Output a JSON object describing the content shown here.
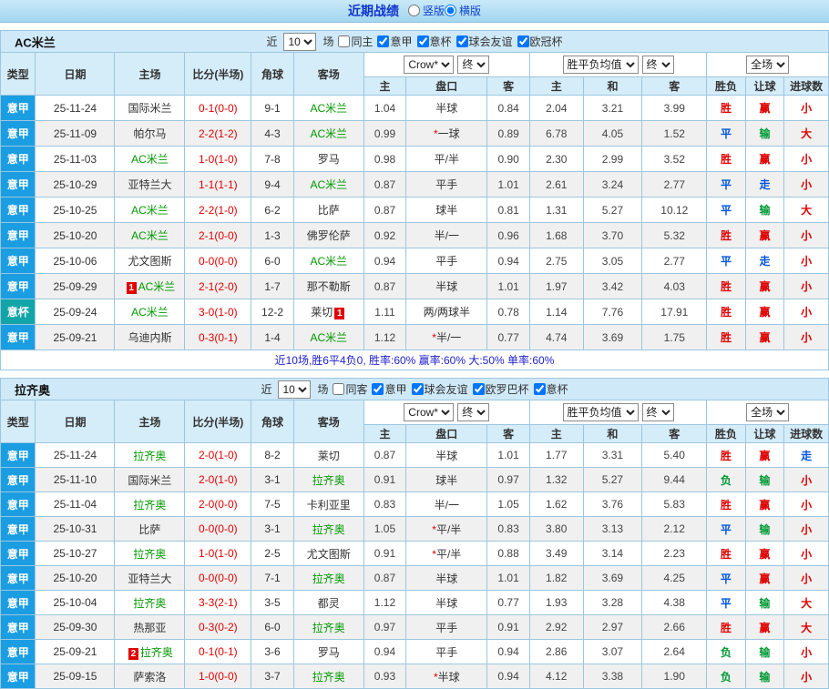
{
  "colors": {
    "topbar_bg": "#a3d6ef",
    "header_bg": "#d5ecf9",
    "border": "#9cc6e0",
    "type_blue": "#1b9de2",
    "type_teal": "#12a5a8",
    "red": "#e00000",
    "green": "#009933",
    "blue": "#0055dd",
    "team_green": "#009900",
    "summary_blue": "#2222cc"
  },
  "top_bar": {
    "title": "近期战绩",
    "layout_options": [
      {
        "label": "竖版",
        "selected": false
      },
      {
        "label": "横版",
        "selected": true
      }
    ]
  },
  "sections": [
    {
      "team": "AC米兰",
      "near_label": "近",
      "matches_count": "10",
      "matches_unit": "场",
      "filters": [
        {
          "label": "同主",
          "checked": false
        },
        {
          "label": "意甲",
          "checked": true
        },
        {
          "label": "意杯",
          "checked": true
        },
        {
          "label": "球会友谊",
          "checked": true
        },
        {
          "label": "欧冠杯",
          "checked": true
        }
      ],
      "odds_company": "Crow*",
      "odds_stage": "终",
      "europe_mode": "胜平负均值",
      "europe_stage": "终",
      "scope": "全场",
      "left_headers": [
        "类型",
        "日期",
        "主场",
        "比分(半场)",
        "角球",
        "客场"
      ],
      "sub_headers": [
        "主",
        "盘口",
        "客",
        "主",
        "和",
        "客",
        "胜负",
        "让球",
        "进球数"
      ],
      "rows": [
        {
          "type": "意甲",
          "date": "25-11-24",
          "home": "国际米兰",
          "home_hl": false,
          "home_badge": "",
          "score": "0-1(0-0)",
          "corners": "9-1",
          "away": "AC米兰",
          "away_hl": true,
          "away_badge": "",
          "asia_home": "1.04",
          "handicap": "半球",
          "asia_away": "0.84",
          "eu_home": "2.04",
          "eu_draw": "3.21",
          "eu_away": "3.99",
          "result": "胜",
          "handicap_result": "赢",
          "goals": "小"
        },
        {
          "type": "意甲",
          "date": "25-11-09",
          "home": "帕尔马",
          "home_hl": false,
          "home_badge": "",
          "score": "2-2(1-2)",
          "corners": "4-3",
          "away": "AC米兰",
          "away_hl": true,
          "away_badge": "",
          "asia_home": "0.99",
          "handicap": "*一球",
          "asia_away": "0.89",
          "eu_home": "6.78",
          "eu_draw": "4.05",
          "eu_away": "1.52",
          "result": "平",
          "handicap_result": "输",
          "goals": "大"
        },
        {
          "type": "意甲",
          "date": "25-11-03",
          "home": "AC米兰",
          "home_hl": true,
          "home_badge": "",
          "score": "1-0(1-0)",
          "corners": "7-8",
          "away": "罗马",
          "away_hl": false,
          "away_badge": "",
          "asia_home": "0.98",
          "handicap": "平/半",
          "asia_away": "0.90",
          "eu_home": "2.30",
          "eu_draw": "2.99",
          "eu_away": "3.52",
          "result": "胜",
          "handicap_result": "赢",
          "goals": "小"
        },
        {
          "type": "意甲",
          "date": "25-10-29",
          "home": "亚特兰大",
          "home_hl": false,
          "home_badge": "",
          "score": "1-1(1-1)",
          "corners": "9-4",
          "away": "AC米兰",
          "away_hl": true,
          "away_badge": "",
          "asia_home": "0.87",
          "handicap": "平手",
          "asia_away": "1.01",
          "eu_home": "2.61",
          "eu_draw": "3.24",
          "eu_away": "2.77",
          "result": "平",
          "handicap_result": "走",
          "goals": "小"
        },
        {
          "type": "意甲",
          "date": "25-10-25",
          "home": "AC米兰",
          "home_hl": true,
          "home_badge": "",
          "score": "2-2(1-0)",
          "corners": "6-2",
          "away": "比萨",
          "away_hl": false,
          "away_badge": "",
          "asia_home": "0.87",
          "handicap": "球半",
          "asia_away": "0.81",
          "eu_home": "1.31",
          "eu_draw": "5.27",
          "eu_away": "10.12",
          "result": "平",
          "handicap_result": "输",
          "goals": "大"
        },
        {
          "type": "意甲",
          "date": "25-10-20",
          "home": "AC米兰",
          "home_hl": true,
          "home_badge": "",
          "score": "2-1(0-0)",
          "corners": "1-3",
          "away": "佛罗伦萨",
          "away_hl": false,
          "away_badge": "",
          "asia_home": "0.92",
          "handicap": "半/一",
          "asia_away": "0.96",
          "eu_home": "1.68",
          "eu_draw": "3.70",
          "eu_away": "5.32",
          "result": "胜",
          "handicap_result": "赢",
          "goals": "小"
        },
        {
          "type": "意甲",
          "date": "25-10-06",
          "home": "尤文图斯",
          "home_hl": false,
          "home_badge": "",
          "score": "0-0(0-0)",
          "corners": "6-0",
          "away": "AC米兰",
          "away_hl": true,
          "away_badge": "",
          "asia_home": "0.94",
          "handicap": "平手",
          "asia_away": "0.94",
          "eu_home": "2.75",
          "eu_draw": "3.05",
          "eu_away": "2.77",
          "result": "平",
          "handicap_result": "走",
          "goals": "小"
        },
        {
          "type": "意甲",
          "date": "25-09-29",
          "home": "AC米兰",
          "home_hl": true,
          "home_badge": "1",
          "score": "2-1(2-0)",
          "corners": "1-7",
          "away": "那不勒斯",
          "away_hl": false,
          "away_badge": "",
          "asia_home": "0.87",
          "handicap": "半球",
          "asia_away": "1.01",
          "eu_home": "1.97",
          "eu_draw": "3.42",
          "eu_away": "4.03",
          "result": "胜",
          "handicap_result": "赢",
          "goals": "小"
        },
        {
          "type": "意杯",
          "date": "25-09-24",
          "home": "AC米兰",
          "home_hl": true,
          "home_badge": "",
          "score": "3-0(1-0)",
          "corners": "12-2",
          "away": "莱切",
          "away_hl": false,
          "away_badge": "1",
          "asia_home": "1.11",
          "handicap": "两/两球半",
          "asia_away": "0.78",
          "eu_home": "1.14",
          "eu_draw": "7.76",
          "eu_away": "17.91",
          "result": "胜",
          "handicap_result": "赢",
          "goals": "小"
        },
        {
          "type": "意甲",
          "date": "25-09-21",
          "home": "乌迪内斯",
          "home_hl": false,
          "home_badge": "",
          "score": "0-3(0-1)",
          "corners": "1-4",
          "away": "AC米兰",
          "away_hl": true,
          "away_badge": "",
          "asia_home": "1.12",
          "handicap": "*半/一",
          "asia_away": "0.77",
          "eu_home": "4.74",
          "eu_draw": "3.69",
          "eu_away": "1.75",
          "result": "胜",
          "handicap_result": "赢",
          "goals": "小"
        }
      ],
      "summary": "近10场,胜6平4负0, 胜率:60% 赢率:60% 大:50% 单率:60%"
    },
    {
      "team": "拉齐奥",
      "near_label": "近",
      "matches_count": "10",
      "matches_unit": "场",
      "filters": [
        {
          "label": "同客",
          "checked": false
        },
        {
          "label": "意甲",
          "checked": true
        },
        {
          "label": "球会友谊",
          "checked": true
        },
        {
          "label": "欧罗巴杯",
          "checked": true
        },
        {
          "label": "意杯",
          "checked": true
        }
      ],
      "odds_company": "Crow*",
      "odds_stage": "终",
      "europe_mode": "胜平负均值",
      "europe_stage": "终",
      "scope": "全场",
      "left_headers": [
        "类型",
        "日期",
        "主场",
        "比分(半场)",
        "角球",
        "客场"
      ],
      "sub_headers": [
        "主",
        "盘口",
        "客",
        "主",
        "和",
        "客",
        "胜负",
        "让球",
        "进球数"
      ],
      "rows": [
        {
          "type": "意甲",
          "date": "25-11-24",
          "home": "拉齐奥",
          "home_hl": true,
          "home_badge": "",
          "score": "2-0(1-0)",
          "corners": "8-2",
          "away": "莱切",
          "away_hl": false,
          "away_badge": "",
          "asia_home": "0.87",
          "handicap": "半球",
          "asia_away": "1.01",
          "eu_home": "1.77",
          "eu_draw": "3.31",
          "eu_away": "5.40",
          "result": "胜",
          "handicap_result": "赢",
          "goals": "走"
        },
        {
          "type": "意甲",
          "date": "25-11-10",
          "home": "国际米兰",
          "home_hl": false,
          "home_badge": "",
          "score": "2-0(1-0)",
          "corners": "3-1",
          "away": "拉齐奥",
          "away_hl": true,
          "away_badge": "",
          "asia_home": "0.91",
          "handicap": "球半",
          "asia_away": "0.97",
          "eu_home": "1.32",
          "eu_draw": "5.27",
          "eu_away": "9.44",
          "result": "负",
          "handicap_result": "输",
          "goals": "小"
        },
        {
          "type": "意甲",
          "date": "25-11-04",
          "home": "拉齐奥",
          "home_hl": true,
          "home_badge": "",
          "score": "2-0(0-0)",
          "corners": "7-5",
          "away": "卡利亚里",
          "away_hl": false,
          "away_badge": "",
          "asia_home": "0.83",
          "handicap": "半/一",
          "asia_away": "1.05",
          "eu_home": "1.62",
          "eu_draw": "3.76",
          "eu_away": "5.83",
          "result": "胜",
          "handicap_result": "赢",
          "goals": "小"
        },
        {
          "type": "意甲",
          "date": "25-10-31",
          "home": "比萨",
          "home_hl": false,
          "home_badge": "",
          "score": "0-0(0-0)",
          "corners": "3-1",
          "away": "拉齐奥",
          "away_hl": true,
          "away_badge": "",
          "asia_home": "1.05",
          "handicap": "*平/半",
          "asia_away": "0.83",
          "eu_home": "3.80",
          "eu_draw": "3.13",
          "eu_away": "2.12",
          "result": "平",
          "handicap_result": "输",
          "goals": "小"
        },
        {
          "type": "意甲",
          "date": "25-10-27",
          "home": "拉齐奥",
          "home_hl": true,
          "home_badge": "",
          "score": "1-0(1-0)",
          "corners": "2-5",
          "away": "尤文图斯",
          "away_hl": false,
          "away_badge": "",
          "asia_home": "0.91",
          "handicap": "*平/半",
          "asia_away": "0.88",
          "eu_home": "3.49",
          "eu_draw": "3.14",
          "eu_away": "2.23",
          "result": "胜",
          "handicap_result": "赢",
          "goals": "小"
        },
        {
          "type": "意甲",
          "date": "25-10-20",
          "home": "亚特兰大",
          "home_hl": false,
          "home_badge": "",
          "score": "0-0(0-0)",
          "corners": "7-1",
          "away": "拉齐奥",
          "away_hl": true,
          "away_badge": "",
          "asia_home": "0.87",
          "handicap": "半球",
          "asia_away": "1.01",
          "eu_home": "1.82",
          "eu_draw": "3.69",
          "eu_away": "4.25",
          "result": "平",
          "handicap_result": "赢",
          "goals": "小"
        },
        {
          "type": "意甲",
          "date": "25-10-04",
          "home": "拉齐奥",
          "home_hl": true,
          "home_badge": "",
          "score": "3-3(2-1)",
          "corners": "3-5",
          "away": "都灵",
          "away_hl": false,
          "away_badge": "",
          "asia_home": "1.12",
          "handicap": "半球",
          "asia_away": "0.77",
          "eu_home": "1.93",
          "eu_draw": "3.28",
          "eu_away": "4.38",
          "result": "平",
          "handicap_result": "输",
          "goals": "大"
        },
        {
          "type": "意甲",
          "date": "25-09-30",
          "home": "热那亚",
          "home_hl": false,
          "home_badge": "",
          "score": "0-3(0-2)",
          "corners": "6-0",
          "away": "拉齐奥",
          "away_hl": true,
          "away_badge": "",
          "asia_home": "0.97",
          "handicap": "平手",
          "asia_away": "0.91",
          "eu_home": "2.92",
          "eu_draw": "2.97",
          "eu_away": "2.66",
          "result": "胜",
          "handicap_result": "赢",
          "goals": "大"
        },
        {
          "type": "意甲",
          "date": "25-09-21",
          "home": "拉齐奥",
          "home_hl": true,
          "home_badge": "2",
          "score": "0-1(0-1)",
          "corners": "3-6",
          "away": "罗马",
          "away_hl": false,
          "away_badge": "",
          "asia_home": "0.94",
          "handicap": "平手",
          "asia_away": "0.94",
          "eu_home": "2.86",
          "eu_draw": "3.07",
          "eu_away": "2.64",
          "result": "负",
          "handicap_result": "输",
          "goals": "小"
        },
        {
          "type": "意甲",
          "date": "25-09-15",
          "home": "萨索洛",
          "home_hl": false,
          "home_badge": "",
          "score": "1-0(0-0)",
          "corners": "3-7",
          "away": "拉齐奥",
          "away_hl": true,
          "away_badge": "",
          "asia_home": "0.93",
          "handicap": "*半球",
          "asia_away": "0.94",
          "eu_home": "4.12",
          "eu_draw": "3.38",
          "eu_away": "1.90",
          "result": "负",
          "handicap_result": "输",
          "goals": "小"
        }
      ],
      "summary": ""
    }
  ]
}
